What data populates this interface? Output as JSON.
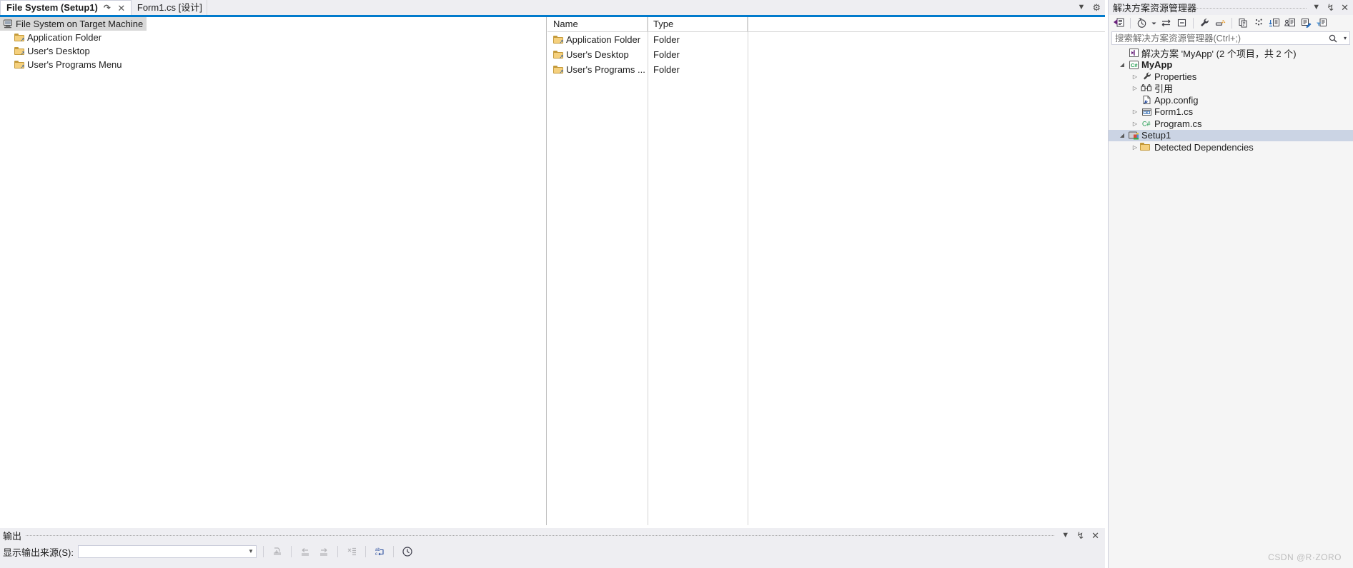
{
  "tabs": {
    "items": [
      {
        "label": "File System (Setup1)",
        "active": true,
        "has_pin": true,
        "has_close": true
      },
      {
        "label": "Form1.cs [设计]",
        "active": false,
        "has_pin": false,
        "has_close": false
      }
    ],
    "right_buttons": [
      {
        "name": "tab-overflow-dropdown",
        "glyph": "▼"
      },
      {
        "name": "tab-settings-gear",
        "glyph": "⚙"
      }
    ],
    "accent_color": "#007acc"
  },
  "file_system_tree": {
    "root": {
      "label": "File System on Target Machine",
      "icon": "target-machine-icon",
      "selected": true
    },
    "children": [
      {
        "label": "Application Folder",
        "icon": "folder-shortcut-icon"
      },
      {
        "label": "User's Desktop",
        "icon": "folder-shortcut-icon"
      },
      {
        "label": "User's Programs Menu",
        "icon": "folder-shortcut-icon"
      }
    ]
  },
  "file_list": {
    "columns": [
      "Name",
      "Type"
    ],
    "rows": [
      {
        "name": "Application Folder",
        "type": "Folder",
        "icon": "folder-shortcut-icon"
      },
      {
        "name": "User's Desktop",
        "type": "Folder",
        "icon": "folder-shortcut-icon"
      },
      {
        "name": "User's Programs ...",
        "type": "Folder",
        "icon": "folder-shortcut-icon"
      }
    ]
  },
  "output": {
    "title": "输出",
    "source_label": "显示输出来源(S):",
    "source_value": "",
    "source_placeholder": "",
    "title_buttons": [
      {
        "name": "output-dropdown-button",
        "glyph": "▼"
      },
      {
        "name": "output-pin-button",
        "glyph": "↯"
      },
      {
        "name": "output-close-button",
        "glyph": "✕"
      }
    ],
    "toolbar_icons": [
      {
        "name": "clear-all-icon",
        "enabled": false
      },
      {
        "name": "go-to-previous-message-icon",
        "enabled": false
      },
      {
        "name": "go-to-next-message-icon",
        "enabled": false
      },
      {
        "name": "toggle-word-wrap-icon",
        "enabled": false
      },
      {
        "name": "toggle-autoscroll-icon",
        "enabled": true
      },
      {
        "name": "show-output-timestamps-icon",
        "enabled": true
      }
    ]
  },
  "solution_explorer": {
    "title": "解决方案资源管理器",
    "header_buttons": [
      {
        "name": "solution-explorer-dropdown-button",
        "glyph": "▼"
      },
      {
        "name": "solution-explorer-pin-button",
        "glyph": "↯"
      },
      {
        "name": "solution-explorer-close-button",
        "glyph": "✕"
      }
    ],
    "toolbar_icons": [
      {
        "name": "solution-explorer-home-icon"
      },
      {
        "name": "back-navigation-history-icon"
      },
      {
        "name": "history-dropdown-icon"
      },
      {
        "name": "sync-with-active-document-icon"
      },
      {
        "name": "collapse-all-icon"
      },
      {
        "name": "properties-wrench-icon"
      },
      {
        "name": "show-all-files-icon"
      },
      {
        "name": "refresh-icon"
      },
      {
        "name": "preview-selected-items-icon"
      },
      {
        "name": "pending-changes-filter-icon"
      },
      {
        "name": "view-code-icon"
      },
      {
        "name": "view-designer-icon"
      },
      {
        "name": "filter-icon"
      }
    ],
    "search": {
      "value": "",
      "placeholder": "搜索解决方案资源管理器(Ctrl+;)",
      "icon": "search-magnifier-icon",
      "dropdown_glyph": "▾"
    },
    "tree": [
      {
        "label": "解决方案 'MyApp' (2 个项目，共 2 个)",
        "icon": "solution-icon",
        "depth": 0,
        "expander": "",
        "bold": false,
        "selected": false
      },
      {
        "label": "MyApp",
        "icon": "csharp-project-icon",
        "depth": 0,
        "expander": "expanded",
        "bold": true,
        "selected": false
      },
      {
        "label": "Properties",
        "icon": "wrench-icon",
        "depth": 1,
        "expander": "collapsed",
        "bold": false,
        "selected": false
      },
      {
        "label": "引用",
        "icon": "references-icon",
        "depth": 1,
        "expander": "collapsed",
        "bold": false,
        "selected": false
      },
      {
        "label": "App.config",
        "icon": "config-file-icon",
        "depth": 1,
        "expander": "",
        "bold": false,
        "selected": false
      },
      {
        "label": "Form1.cs",
        "icon": "windows-form-icon",
        "depth": 1,
        "expander": "collapsed",
        "bold": false,
        "selected": false
      },
      {
        "label": "Program.cs",
        "icon": "csharp-file-icon",
        "depth": 1,
        "expander": "collapsed",
        "bold": false,
        "selected": false
      },
      {
        "label": "Setup1",
        "icon": "setup-project-icon",
        "depth": 0,
        "expander": "expanded",
        "bold": false,
        "selected": true
      },
      {
        "label": "Detected Dependencies",
        "icon": "folder-plain-icon",
        "depth": 1,
        "expander": "collapsed",
        "bold": false,
        "selected": false
      }
    ]
  },
  "watermark": {
    "text": "CSDN @R·ZORO"
  },
  "colors": {
    "accent": "#007acc",
    "selection": "#cbd4e4",
    "tree_selection": "#d8d8d8",
    "chrome": "#eeeef2",
    "panel_bg": "#f5f5f5"
  }
}
